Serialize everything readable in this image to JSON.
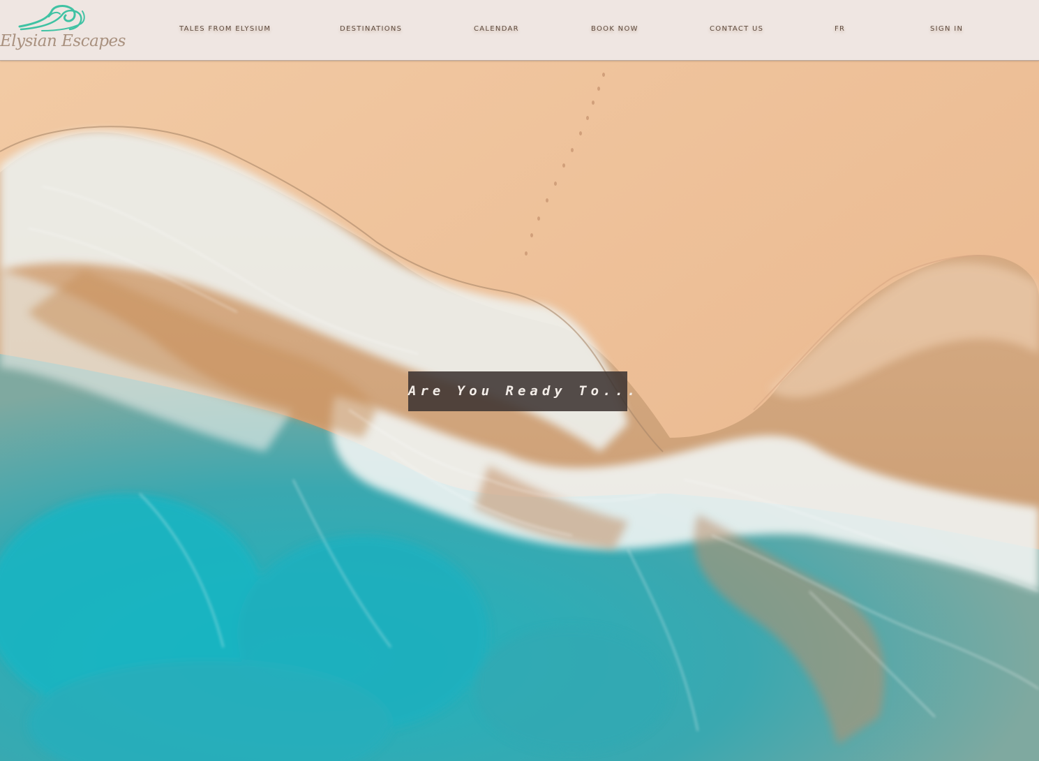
{
  "brand": {
    "name": "Elysian Escapes",
    "logo_icon": "wave-icon",
    "logo_color": "#3fc2a3"
  },
  "nav": {
    "items": [
      {
        "label": "TALES FROM ELYSIUM"
      },
      {
        "label": "DESTINATIONS"
      },
      {
        "label": "CALENDAR"
      },
      {
        "label": "BOOK NOW"
      },
      {
        "label": "CONTACT US"
      },
      {
        "label": "FR"
      },
      {
        "label": "SIGN IN"
      }
    ]
  },
  "hero": {
    "image_description": "aerial-beach-waves",
    "cta_text": "Are You Ready To..."
  },
  "colors": {
    "header_bg": "#efe6e2",
    "nav_text": "#5e4a3d",
    "sand": "#efc39c",
    "sea": "#2fa9b5",
    "foam": "#eef3f3",
    "cta_bg": "#3e3432"
  }
}
